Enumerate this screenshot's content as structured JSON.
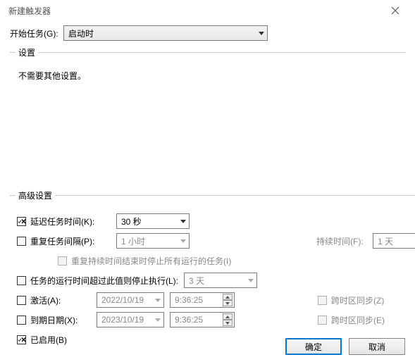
{
  "window": {
    "title": "新建触发器"
  },
  "begin": {
    "label": "开始任务(G):",
    "value": "启动时"
  },
  "settings": {
    "legend": "设置",
    "text": "不需要其他设置。"
  },
  "advanced": {
    "legend": "高级设置",
    "delay": {
      "label": "延迟任务时间(K):",
      "value": "30 秒",
      "checked": true
    },
    "repeat": {
      "label": "重复任务间隔(P):",
      "value": "1 小时",
      "checked": false,
      "duration_label": "持续时间(F):",
      "duration_value": "1 天"
    },
    "stop_repeat": {
      "label": "重复持续时间结束时停止所有运行的任务(I)"
    },
    "stop_after": {
      "label": "任务的运行时间超过此值则停止执行(L):",
      "value": "3 天",
      "checked": false
    },
    "activate": {
      "label": "激活(A):",
      "date": "2022/10/19",
      "time": "9:36:25",
      "checked": false,
      "sync_label": "跨时区同步(Z)"
    },
    "expire": {
      "label": "到期日期(X):",
      "date": "2023/10/19",
      "time": "9:36:25",
      "checked": false,
      "sync_label": "跨时区同步(E)"
    },
    "enabled": {
      "label": "已启用(B)",
      "checked": true
    }
  },
  "buttons": {
    "ok": "确定",
    "cancel": "取消"
  }
}
